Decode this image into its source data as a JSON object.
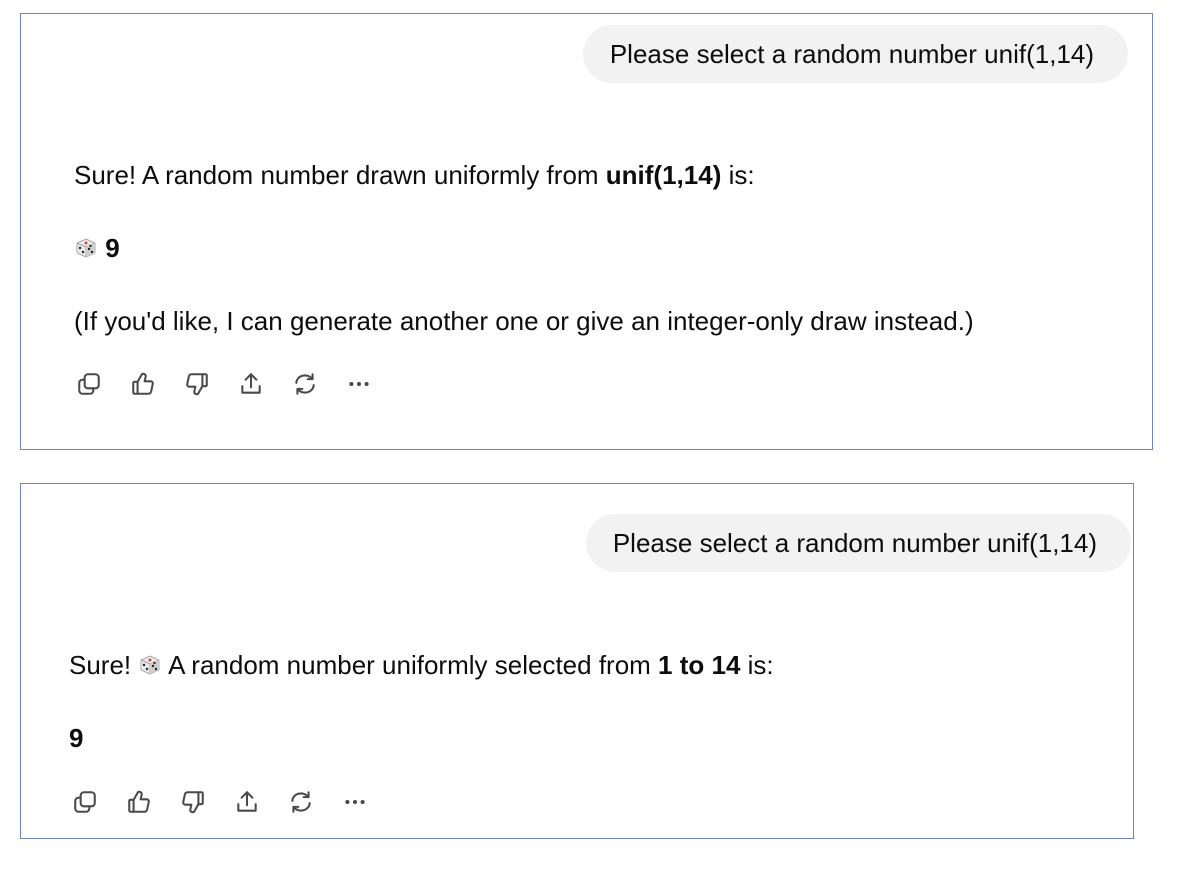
{
  "conversations": [
    {
      "user_message": "Please select a random number unif(1,14)",
      "assistant": {
        "line1_prefix": "Sure! A random number drawn uniformly from ",
        "line1_bold": "unif(1,14)",
        "line1_suffix": " is:",
        "result_number": "9",
        "note": "(If you'd like, I can generate another one or give an integer-only draw instead.)"
      }
    },
    {
      "user_message": "Please select a random number unif(1,14)",
      "assistant": {
        "line1_prefix": "Sure! ",
        "line1_middle": " A random number uniformly selected from ",
        "line1_bold": "1 to 14",
        "line1_suffix": " is:",
        "result_number": "9"
      }
    }
  ],
  "icons": {
    "dice": "game-die-icon",
    "actions": [
      "copy-icon",
      "thumbs-up-icon",
      "thumbs-down-icon",
      "share-icon",
      "regenerate-icon",
      "more-icon"
    ]
  },
  "colors": {
    "panel_border": "#6b85c4",
    "user_bubble_bg": "#f2f2f2",
    "text": "#0d0d0d",
    "icon": "#4a4a4a"
  }
}
